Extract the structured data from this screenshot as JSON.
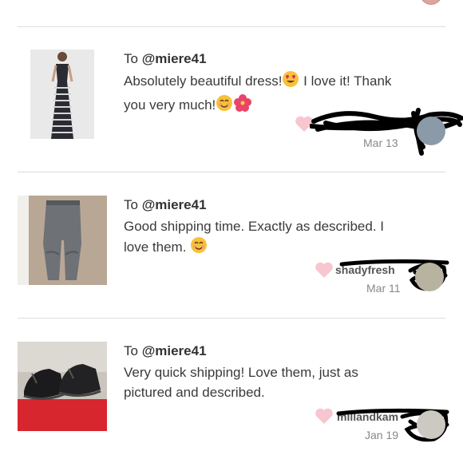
{
  "reviews": [
    {
      "to_prefix": "To ",
      "to_handle": "@miere41",
      "text_lines": [
        "Absolutely beautiful dress!",
        "you very much!"
      ],
      "text_tail_line1": " I love it! Thank",
      "emojis_line1": [
        "heart-eyes-emoji"
      ],
      "emojis_line2": [
        "smile-emoji",
        "hibiscus-emoji"
      ],
      "reviewer": "",
      "date": "Mar 13",
      "product": "striped maxi dress"
    },
    {
      "to_prefix": "To ",
      "to_handle": "@miere41",
      "text_lines": [
        "Good shipping time. Exactly as described. I",
        "love them."
      ],
      "emojis_line2": [
        "smile-emoji"
      ],
      "reviewer": "shadyfresh",
      "date": "Mar 11",
      "product": "grey jogger pants"
    },
    {
      "to_prefix": "To ",
      "to_handle": "@miere41",
      "text_lines": [
        "Very quick shipping! Love them, just as",
        "pictured and described."
      ],
      "reviewer": "millandkam",
      "date": "Jan 19",
      "product": "black sneakers"
    }
  ],
  "colors": {
    "heart": "#f7c6cf",
    "divider": "#dcdcdc",
    "date": "#888888",
    "text": "#3a3a3a"
  }
}
